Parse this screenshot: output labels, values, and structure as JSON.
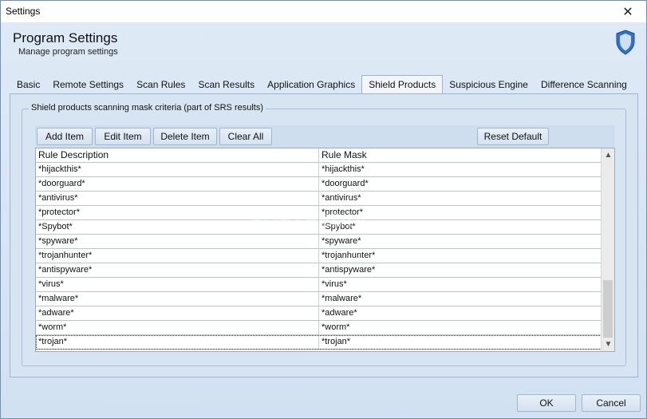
{
  "window": {
    "title": "Settings",
    "close_symbol": "✕"
  },
  "header": {
    "title": "Program Settings",
    "subtitle": "Manage program settings",
    "icon": "shield-icon"
  },
  "tabs": [
    {
      "label": "Basic"
    },
    {
      "label": "Remote Settings"
    },
    {
      "label": "Scan Rules"
    },
    {
      "label": "Scan Results"
    },
    {
      "label": "Application Graphics"
    },
    {
      "label": "Shield Products",
      "active": true
    },
    {
      "label": "Suspicious Engine"
    },
    {
      "label": "Difference Scanning"
    }
  ],
  "groupbox": {
    "legend": "Shield products scanning mask criteria (part of SRS results)"
  },
  "toolbar": {
    "add_item": "Add Item",
    "edit_item": "Edit Item",
    "delete_item": "Delete Item",
    "clear_all": "Clear All",
    "reset_default": "Reset Default"
  },
  "watermark": "SOFTPEDIA",
  "table": {
    "columns": [
      "Rule Description",
      "Rule Mask"
    ],
    "rows": [
      [
        "*hijackthis*",
        "*hijackthis*"
      ],
      [
        "*doorguard*",
        "*doorguard*"
      ],
      [
        "*antivirus*",
        "*antivirus*"
      ],
      [
        "*protector*",
        "*protector*"
      ],
      [
        "*Spybot*",
        "*Spybot*"
      ],
      [
        "*spyware*",
        "*spyware*"
      ],
      [
        "*trojanhunter*",
        "*trojanhunter*"
      ],
      [
        "*antispyware*",
        "*antispyware*"
      ],
      [
        "*virus*",
        "*virus*"
      ],
      [
        "*malware*",
        "*malware*"
      ],
      [
        "*adware*",
        "*adware*"
      ],
      [
        "*worm*",
        "*worm*"
      ],
      [
        "*trojan*",
        "*trojan*"
      ]
    ],
    "selected_row": 12
  },
  "footer": {
    "ok": "OK",
    "cancel": "Cancel"
  },
  "colors": {
    "accent": "#2f73c6",
    "shield_light": "#cfe0f5"
  }
}
